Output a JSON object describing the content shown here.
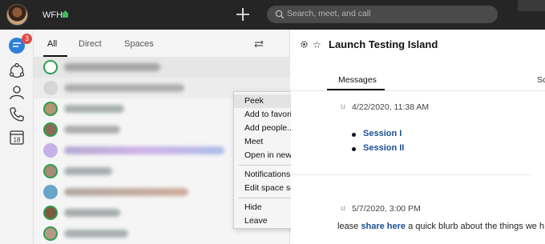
{
  "topbar": {
    "status_text": "WFH",
    "search_placeholder": "Search, meet, and call"
  },
  "rail": {
    "messaging_badge": "3",
    "calendar_day": "18"
  },
  "list": {
    "tabs": [
      "All",
      "Direct",
      "Spaces"
    ]
  },
  "context_menu": {
    "group1": [
      "Peek",
      "Add to favorites",
      "Add people...",
      "Meet",
      "Open in new window"
    ],
    "group2": [
      "Notifications...",
      "Edit space settings..."
    ],
    "group3": [
      "Hide",
      "Leave"
    ]
  },
  "space": {
    "title": "Launch Testing Island",
    "tabs": [
      "Messages",
      "Sc"
    ],
    "msg1_timestamp": "4/22/2020, 11:38 AM",
    "sessions": [
      "Session I",
      "Session II"
    ],
    "msg2_timestamp": "5/7/2020, 3:00 PM",
    "msg2_prefix": "lease ",
    "msg2_link": "share here",
    "msg2_suffix": " a quick blurb about the things we h"
  },
  "colors": {
    "topbar_bg": "#252525",
    "accent_link": "#1c4f8f",
    "badge": "#e04848"
  }
}
